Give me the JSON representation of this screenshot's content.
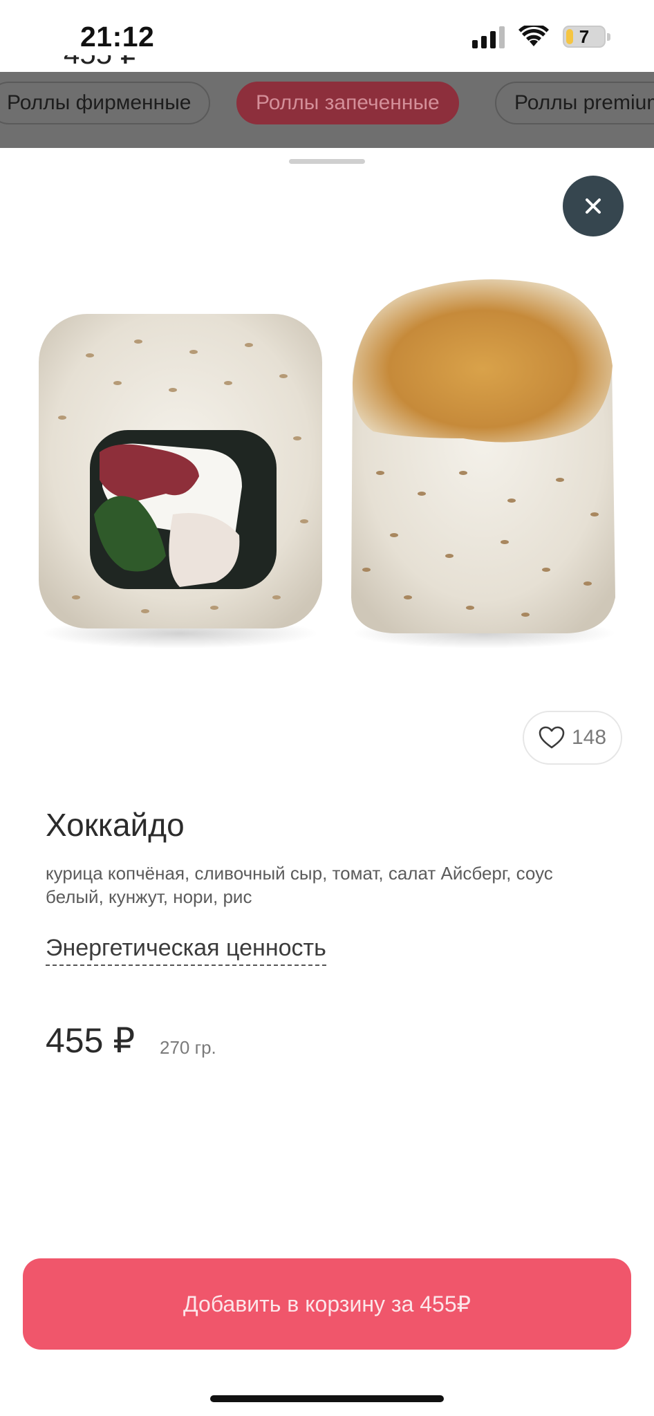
{
  "status_bar": {
    "time": "21:12",
    "battery_level": "7",
    "signal_bars": 3,
    "wifi": true
  },
  "background": {
    "peek_price": "455 ₽",
    "categories": [
      {
        "label": "Роллы фирменные",
        "active": false
      },
      {
        "label": "Роллы запеченные",
        "active": true
      },
      {
        "label": "Роллы premium",
        "active": false
      }
    ]
  },
  "sheet": {
    "close_icon": "close-icon",
    "image_icon": "sushi-roll-photo",
    "likes": "148",
    "like_icon": "heart-icon",
    "title": "Хоккайдо",
    "description": "курица копчёная, сливочный сыр, томат, салат Айсберг, соус белый, кунжут, нори, рис",
    "energy_link": "Энергетическая ценность",
    "price": "455 ₽",
    "weight": "270 гр.",
    "add_button_label": "Добавить в корзину за 455₽"
  },
  "colors": {
    "accent": "#f0566b",
    "close_button": "#36464f",
    "active_category": "#8d2f3c",
    "overlay": "#6f6f6f"
  }
}
